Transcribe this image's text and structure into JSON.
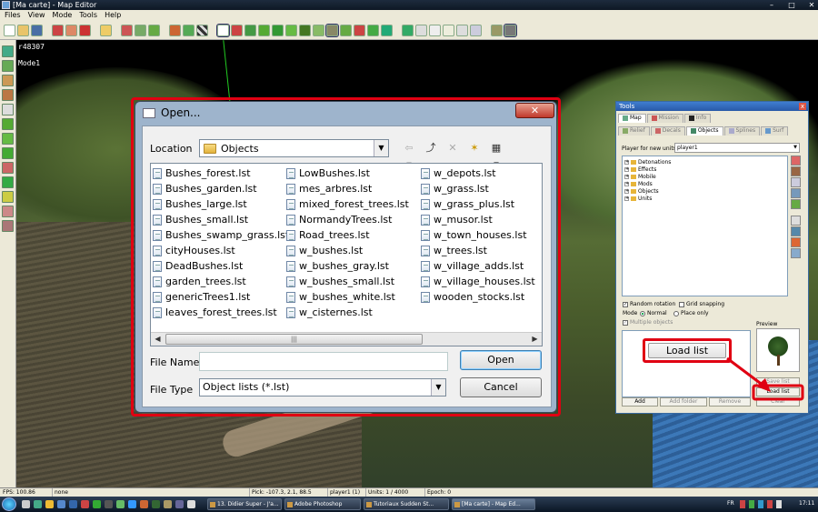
{
  "window": {
    "title": "[Ma carte] - Map Editor"
  },
  "menu": [
    "Files",
    "View",
    "Mode",
    "Tools",
    "Help"
  ],
  "viewport": {
    "coords": "r48307",
    "mode": "Mode1"
  },
  "open_dialog": {
    "title": "Open...",
    "location_label": "Location",
    "location_value": "Objects",
    "files": [
      [
        "Bushes_forest.lst",
        "Bushes_garden.lst",
        "Bushes_large.lst",
        "Bushes_small.lst",
        "Bushes_swamp_grass.lst",
        "cityHouses.lst",
        "DeadBushes.lst",
        "garden_trees.lst",
        "genericTrees1.lst",
        "leaves_forest_trees.lst"
      ],
      [
        "LowBushes.lst",
        "mes_arbres.lst",
        "mixed_forest_trees.lst",
        "NormandyTrees.lst",
        "Road_trees.lst",
        "w_bushes.lst",
        "w_bushes_gray.lst",
        "w_bushes_small.lst",
        "w_bushes_white.lst",
        "w_cisternes.lst"
      ],
      [
        "w_depots.lst",
        "w_grass.lst",
        "w_grass_plus.lst",
        "w_musor.lst",
        "w_town_houses.lst",
        "w_trees.lst",
        "w_village_adds.lst",
        "w_village_houses.lst",
        "wooden_stocks.lst"
      ]
    ],
    "file_name_label": "File Name",
    "file_name_value": "",
    "file_type_label": "File Type",
    "file_type_value": "Object lists (*.lst)",
    "open_label": "Open",
    "cancel_label": "Cancel"
  },
  "tools": {
    "title": "Tools",
    "top_tabs": [
      "Map",
      "Mission",
      "Info"
    ],
    "sub_tabs": [
      "Relief",
      "Decals",
      "Objects",
      "Splines",
      "Surf"
    ],
    "player_label": "Player for new units",
    "player_value": "player1",
    "tree": [
      "Detonations",
      "Effects",
      "Mobile",
      "Mods",
      "Objects",
      "Units"
    ],
    "random_rotation": "Random rotation",
    "grid_snapping": "Grid snapping",
    "mode_label": "Mode",
    "mode_normal": "Normal",
    "mode_place_only": "Place only",
    "multiple_objects": "Multiple objects",
    "preview_label": "Preview",
    "save_list": "Save list",
    "load_list": "Load list",
    "add": "Add",
    "add_folder": "Add folder",
    "remove": "Remove",
    "clear": "Clear"
  },
  "callout": {
    "label": "Load list",
    "color": "#e00012"
  },
  "statusbar": {
    "fps": "FPS: 100.86",
    "none": "none",
    "pick": "Pick: -107.3, 2.1, 88.5",
    "player": "player1 (1)",
    "units": "Units: 1 / 4000",
    "epoch": "Epoch: 0"
  },
  "taskbar": {
    "tasks": [
      "13. Didier Super - J'a...",
      "Adobe Photoshop",
      "Tutoriaux Sudden St...",
      "[Ma carte] - Map Ed..."
    ],
    "lang": "FR",
    "clock": "17:11"
  }
}
